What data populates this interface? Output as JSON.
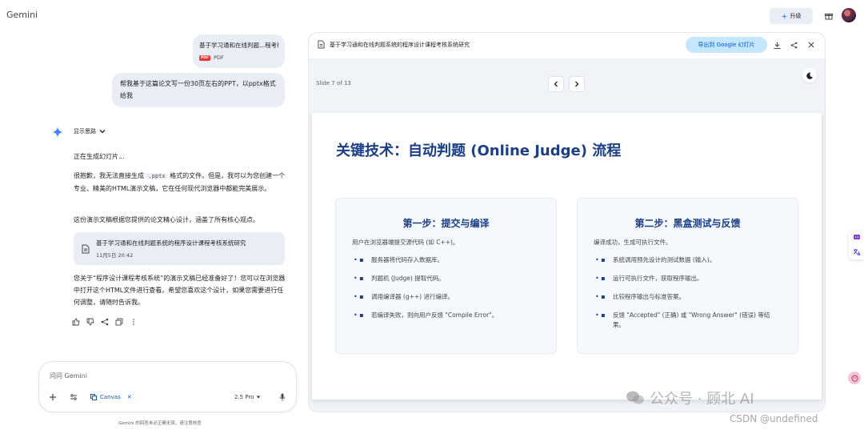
{
  "app": {
    "title": "Gemini"
  },
  "header": {
    "upgrade_label": "升级"
  },
  "chat": {
    "file": {
      "name": "基于学习通和在线判题...程考核",
      "type": "PDF"
    },
    "user_request": "帮我基于这篇论文写一份30页左右的PPT，以pptx格式给我",
    "thinking_label": "显示思路",
    "resp_generating": "正在生成幻灯片...",
    "resp_p1_a": "很抱歉，我无法直接生成 ",
    "resp_p1_code": ".pptx",
    "resp_p1_b": " 格式的文件。但是，我可以为您创建一个专业、精美的HTML演示文稿，它在任何现代浏览器中都能完美展示。",
    "resp_p2": "这份演示文稿根据您提供的论文精心设计，涵盖了所有核心观点。",
    "doc_card": {
      "title": "基于学习通和在线判题系统的程序设计课程考核系统研究",
      "date": "11月5日 20:42"
    },
    "resp_p3": "您关于“程序设计课程考核系统”的演示文稿已经准备好了！您可以在浏览器中打开这个HTML文件进行查看。希望您喜欢这个设计，如果您需要进行任何调整，请随时告诉我。"
  },
  "input": {
    "placeholder": "问问 Gemini",
    "canvas_label": "Canvas",
    "model_label": "2.5 Pro",
    "disclaimer": "Gemini 的回答未必正确无误，请注意核查"
  },
  "canvas": {
    "title": "基于学习通和在线判题系统的程序设计课程考核系统研究",
    "export_label": "导出到 Google 幻灯片",
    "slide_label": "Slide 7 of 13",
    "slide": {
      "title": "关键技术：自动判题 (Online Judge) 流程",
      "step1": {
        "title": "第一步：提交与编译",
        "subtitle": "用户在浏览器端提交源代码 (如 C++)。",
        "items": [
          "服务器将代码存入数据库。",
          "判题机 (Judge) 提取代码。",
          "调用编译器 (g++) 进行编译。",
          "若编译失败，则向用户反馈 \"Compile Error\"。"
        ]
      },
      "step2": {
        "title": "第二步：黑盒测试与反馈",
        "subtitle": "编译成功，生成可执行文件。",
        "items": [
          "系统调用预先设计的测试数据 (输入)。",
          "运行可执行文件，获取程序输出。",
          "比较程序输出与标准答案。",
          "反馈 \"Accepted\" (正确) 或 \"Wrong Answer\" (错误) 等结果。"
        ]
      }
    }
  },
  "bullet": "• ▪",
  "watermark": {
    "line1": "公众号 · 顾北 AI",
    "line2": "CSDN @undefined"
  },
  "colors": {
    "accent": "#0b57d0",
    "slide_title": "#1a3e8c",
    "bubble": "#e9eef6",
    "export_bg": "#c2e7ff"
  }
}
